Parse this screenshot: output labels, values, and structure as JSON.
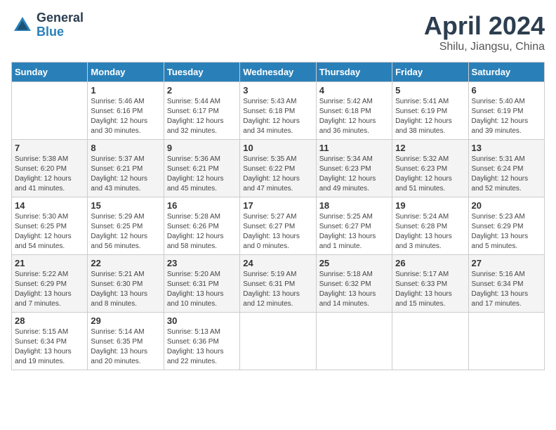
{
  "logo": {
    "general": "General",
    "blue": "Blue"
  },
  "title": "April 2024",
  "location": "Shilu, Jiangsu, China",
  "days_of_week": [
    "Sunday",
    "Monday",
    "Tuesday",
    "Wednesday",
    "Thursday",
    "Friday",
    "Saturday"
  ],
  "weeks": [
    [
      {
        "num": "",
        "info": ""
      },
      {
        "num": "1",
        "info": "Sunrise: 5:46 AM\nSunset: 6:16 PM\nDaylight: 12 hours\nand 30 minutes."
      },
      {
        "num": "2",
        "info": "Sunrise: 5:44 AM\nSunset: 6:17 PM\nDaylight: 12 hours\nand 32 minutes."
      },
      {
        "num": "3",
        "info": "Sunrise: 5:43 AM\nSunset: 6:18 PM\nDaylight: 12 hours\nand 34 minutes."
      },
      {
        "num": "4",
        "info": "Sunrise: 5:42 AM\nSunset: 6:18 PM\nDaylight: 12 hours\nand 36 minutes."
      },
      {
        "num": "5",
        "info": "Sunrise: 5:41 AM\nSunset: 6:19 PM\nDaylight: 12 hours\nand 38 minutes."
      },
      {
        "num": "6",
        "info": "Sunrise: 5:40 AM\nSunset: 6:19 PM\nDaylight: 12 hours\nand 39 minutes."
      }
    ],
    [
      {
        "num": "7",
        "info": "Sunrise: 5:38 AM\nSunset: 6:20 PM\nDaylight: 12 hours\nand 41 minutes."
      },
      {
        "num": "8",
        "info": "Sunrise: 5:37 AM\nSunset: 6:21 PM\nDaylight: 12 hours\nand 43 minutes."
      },
      {
        "num": "9",
        "info": "Sunrise: 5:36 AM\nSunset: 6:21 PM\nDaylight: 12 hours\nand 45 minutes."
      },
      {
        "num": "10",
        "info": "Sunrise: 5:35 AM\nSunset: 6:22 PM\nDaylight: 12 hours\nand 47 minutes."
      },
      {
        "num": "11",
        "info": "Sunrise: 5:34 AM\nSunset: 6:23 PM\nDaylight: 12 hours\nand 49 minutes."
      },
      {
        "num": "12",
        "info": "Sunrise: 5:32 AM\nSunset: 6:23 PM\nDaylight: 12 hours\nand 51 minutes."
      },
      {
        "num": "13",
        "info": "Sunrise: 5:31 AM\nSunset: 6:24 PM\nDaylight: 12 hours\nand 52 minutes."
      }
    ],
    [
      {
        "num": "14",
        "info": "Sunrise: 5:30 AM\nSunset: 6:25 PM\nDaylight: 12 hours\nand 54 minutes."
      },
      {
        "num": "15",
        "info": "Sunrise: 5:29 AM\nSunset: 6:25 PM\nDaylight: 12 hours\nand 56 minutes."
      },
      {
        "num": "16",
        "info": "Sunrise: 5:28 AM\nSunset: 6:26 PM\nDaylight: 12 hours\nand 58 minutes."
      },
      {
        "num": "17",
        "info": "Sunrise: 5:27 AM\nSunset: 6:27 PM\nDaylight: 13 hours\nand 0 minutes."
      },
      {
        "num": "18",
        "info": "Sunrise: 5:25 AM\nSunset: 6:27 PM\nDaylight: 13 hours\nand 1 minute."
      },
      {
        "num": "19",
        "info": "Sunrise: 5:24 AM\nSunset: 6:28 PM\nDaylight: 13 hours\nand 3 minutes."
      },
      {
        "num": "20",
        "info": "Sunrise: 5:23 AM\nSunset: 6:29 PM\nDaylight: 13 hours\nand 5 minutes."
      }
    ],
    [
      {
        "num": "21",
        "info": "Sunrise: 5:22 AM\nSunset: 6:29 PM\nDaylight: 13 hours\nand 7 minutes."
      },
      {
        "num": "22",
        "info": "Sunrise: 5:21 AM\nSunset: 6:30 PM\nDaylight: 13 hours\nand 8 minutes."
      },
      {
        "num": "23",
        "info": "Sunrise: 5:20 AM\nSunset: 6:31 PM\nDaylight: 13 hours\nand 10 minutes."
      },
      {
        "num": "24",
        "info": "Sunrise: 5:19 AM\nSunset: 6:31 PM\nDaylight: 13 hours\nand 12 minutes."
      },
      {
        "num": "25",
        "info": "Sunrise: 5:18 AM\nSunset: 6:32 PM\nDaylight: 13 hours\nand 14 minutes."
      },
      {
        "num": "26",
        "info": "Sunrise: 5:17 AM\nSunset: 6:33 PM\nDaylight: 13 hours\nand 15 minutes."
      },
      {
        "num": "27",
        "info": "Sunrise: 5:16 AM\nSunset: 6:34 PM\nDaylight: 13 hours\nand 17 minutes."
      }
    ],
    [
      {
        "num": "28",
        "info": "Sunrise: 5:15 AM\nSunset: 6:34 PM\nDaylight: 13 hours\nand 19 minutes."
      },
      {
        "num": "29",
        "info": "Sunrise: 5:14 AM\nSunset: 6:35 PM\nDaylight: 13 hours\nand 20 minutes."
      },
      {
        "num": "30",
        "info": "Sunrise: 5:13 AM\nSunset: 6:36 PM\nDaylight: 13 hours\nand 22 minutes."
      },
      {
        "num": "",
        "info": ""
      },
      {
        "num": "",
        "info": ""
      },
      {
        "num": "",
        "info": ""
      },
      {
        "num": "",
        "info": ""
      }
    ]
  ]
}
